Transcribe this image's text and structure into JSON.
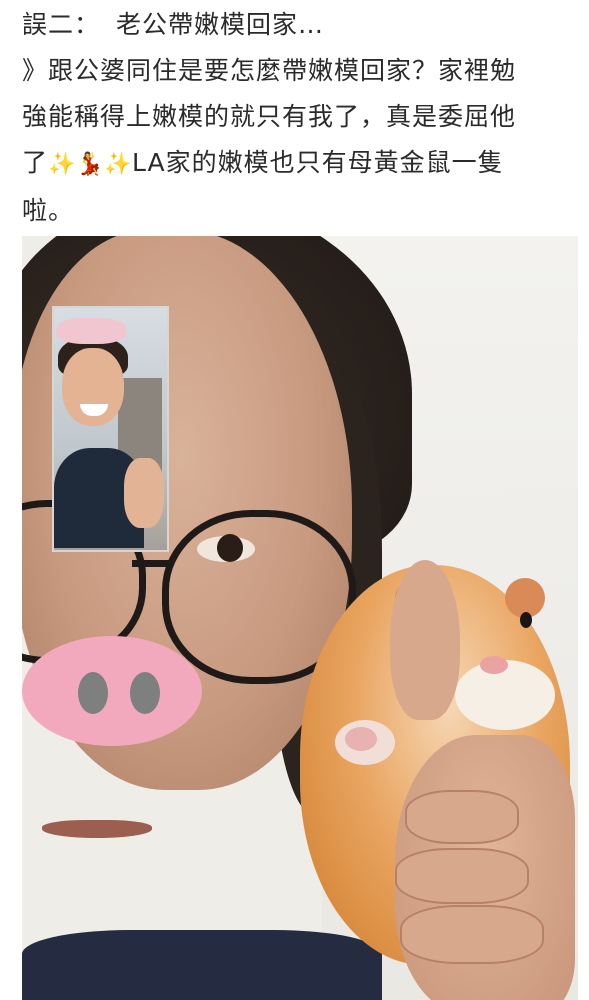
{
  "post": {
    "lines": [
      {
        "text": "誤二：",
        "text2": "老公帶嫩模回家…"
      },
      {
        "text": "》跟公婆同住是要怎麼帶嫩模回家？家裡勉"
      },
      {
        "text": "強能稱得上嫩模的就只有我了，真是委屈他"
      },
      {
        "pre": "了",
        "post": "LA家的嫩模也只有母黃金鼠一隻"
      },
      {
        "text": "啦。"
      }
    ],
    "emojis": [
      "sparkles",
      "woman-dancing",
      "sparkles"
    ]
  },
  "colors": {
    "text": "#2b2b2b",
    "pig_nose": "#f3a9bd",
    "hamster": "#e9a561"
  }
}
